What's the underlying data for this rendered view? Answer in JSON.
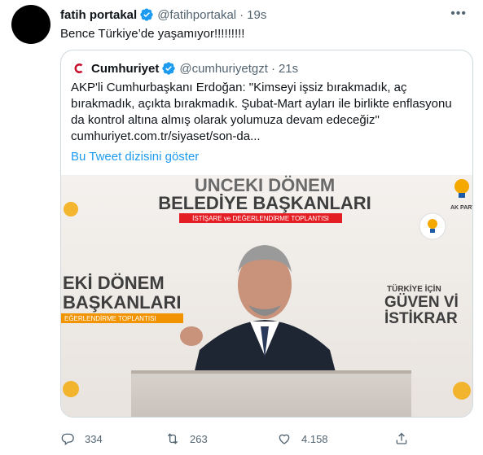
{
  "tweet": {
    "author_name": "fatih portakal",
    "handle": "@fatihportakal",
    "time": "19s",
    "text": "Bence Türkiye’de yaşamıyor!!!!!!!!!",
    "more_icon": "more-icon"
  },
  "quote": {
    "author_name": "Cumhuriyet",
    "handle": "@cumhuriyetgzt",
    "time": "21s",
    "text": "AKP'li Cumhurbaşkanı Erdoğan: \"Kimseyi işsiz bırakmadık, aç bırakmadık, açıkta bırakmadık. Şubat-Mart ayları ile birlikte enflasyonu da kontrol altına almış olarak yolumuza devam edeceğiz\" cumhuriyet.com.tr/siyaset/son-da...",
    "thread_link": "Bu Tweet dizisini göster",
    "image": {
      "banner_line1": "UNCEKI DÖNEM",
      "banner_line2": "BELEDİYE BAŞKANLARI",
      "banner_sub": "İSTİŞARE ve DEĞERLENDİRME TOPLANTISI",
      "left_line1": "EKİ DÖNEM",
      "left_line2": "BAŞKANLARI",
      "left_sub": "EĞERLENDİRME TOPLANTISI",
      "right_line1": "TÜRKİYE İÇİN",
      "right_line2": "GÜVEN Vİ",
      "right_line3": "İSTİKRAR",
      "party_tag": "AK PARTİ"
    }
  },
  "actions": {
    "reply_count": "334",
    "retweet_count": "263",
    "like_count": "4.158"
  },
  "colors": {
    "accent": "#1d9bf0",
    "muted": "#536471",
    "border": "#cfd9de",
    "brand_red": "#c8102e"
  }
}
